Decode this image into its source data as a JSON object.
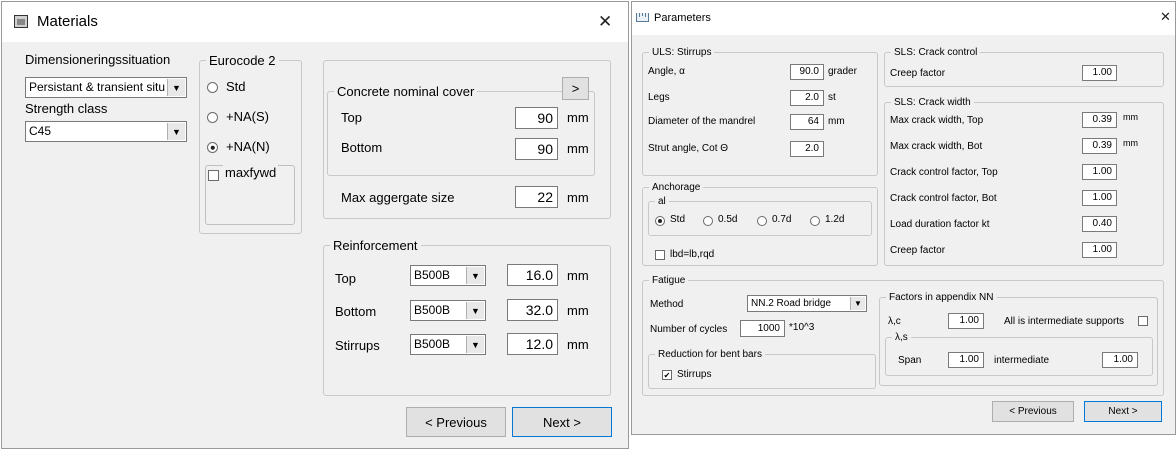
{
  "materials": {
    "title": "Materials",
    "close": "✕",
    "dim_label": "Dimensioneringssituation",
    "dim_value": "Persistant & transient situ",
    "strength_label": "Strength class",
    "strength_value": "C45",
    "eurocode": {
      "legend": "Eurocode 2",
      "options": [
        "Std",
        "+NA(S)",
        "+NA(N)"
      ],
      "selected": "+NA(N)",
      "maxfywd_label": "maxfywd"
    },
    "cover": {
      "legend": "Concrete nominal cover",
      "arrow": ">",
      "top_label": "Top",
      "top_value": "90",
      "top_unit": "mm",
      "bottom_label": "Bottom",
      "bottom_value": "90",
      "bottom_unit": "mm"
    },
    "aggregate": {
      "label": "Max aggergate size",
      "value": "22",
      "unit": "mm"
    },
    "reinforcement": {
      "legend": "Reinforcement",
      "rows": [
        {
          "label": "Top",
          "grade": "B500B",
          "value": "16.0",
          "unit": "mm"
        },
        {
          "label": "Bottom",
          "grade": "B500B",
          "value": "32.0",
          "unit": "mm"
        },
        {
          "label": "Stirrups",
          "grade": "B500B",
          "value": "12.0",
          "unit": "mm"
        }
      ]
    },
    "prev": "< Previous",
    "next": "Next >"
  },
  "parameters": {
    "title": "Parameters",
    "close": "✕",
    "uls": {
      "legend": "ULS: Stirrups",
      "angle_label": "Angle, α",
      "angle_value": "90.0",
      "angle_unit": "grader",
      "legs_label": "Legs",
      "legs_value": "2.0",
      "legs_unit": "st",
      "mandrel_label": "Diameter of the mandrel",
      "mandrel_value": "64",
      "mandrel_unit": "mm",
      "strut_label": "Strut angle, Cot Θ",
      "strut_value": "2.0"
    },
    "anchorage": {
      "legend": "Anchorage",
      "al_legend": "al",
      "options": [
        "Std",
        "0.5d",
        "0.7d",
        "1.2d"
      ],
      "selected": "Std",
      "lbd_label": "lbd=lb,rqd"
    },
    "sls_control": {
      "legend": "SLS: Crack control",
      "creep_label": "Creep factor",
      "creep_value": "1.00"
    },
    "sls_width": {
      "legend": "SLS: Crack width",
      "rows": [
        {
          "label": "Max crack width, Top",
          "value": "0.39",
          "unit": "mm"
        },
        {
          "label": "Max crack width, Bot",
          "value": "0.39",
          "unit": "mm"
        },
        {
          "label": "Crack control factor, Top",
          "value": "1.00",
          "unit": ""
        },
        {
          "label": "Crack control factor, Bot",
          "value": "1.00",
          "unit": ""
        },
        {
          "label": "Load duration factor kt",
          "value": "0.40",
          "unit": ""
        },
        {
          "label": "Creep factor",
          "value": "1.00",
          "unit": ""
        }
      ]
    },
    "fatigue": {
      "legend": "Fatigue",
      "method_label": "Method",
      "method_value": "NN.2 Road bridge",
      "cycles_label": "Number of cycles",
      "cycles_value": "1000",
      "cycles_unit": "*10^3",
      "reduction_legend": "Reduction for bent bars",
      "stirrups_label": "Stirrups",
      "factors_legend": "Factors in appendix NN",
      "lc_label": "λ,c",
      "lc_value": "1.00",
      "intermediate_label": "All is intermediate supports",
      "ls_legend": "λ,s",
      "span_label": "Span",
      "span_value": "1.00",
      "inter_label": "intermediate",
      "inter_value": "1.00"
    },
    "prev": "< Previous",
    "next": "Next >"
  },
  "icons": {
    "window_icon": "window-icon",
    "parameters_icon": "ruler-icon",
    "dropdown": "▼",
    "check": "✔"
  }
}
